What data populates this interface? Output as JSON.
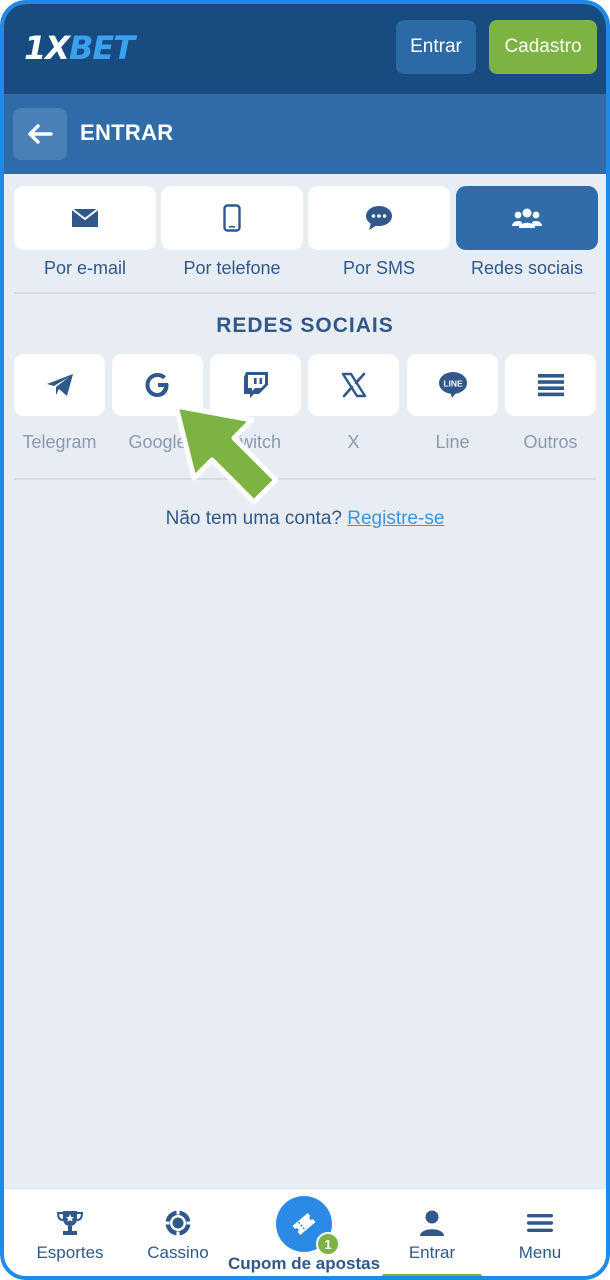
{
  "header": {
    "logo_prefix": "1X",
    "logo_suffix": "BET",
    "login_label": "Entrar",
    "register_label": "Cadastro"
  },
  "subheader": {
    "title": "ENTRAR"
  },
  "methods": [
    {
      "label": "Por e-mail",
      "icon": "envelope-icon",
      "active": false
    },
    {
      "label": "Por telefone",
      "icon": "phone-icon",
      "active": false
    },
    {
      "label": "Por SMS",
      "icon": "sms-icon",
      "active": false
    },
    {
      "label": "Redes sociais",
      "icon": "users-icon",
      "active": true
    }
  ],
  "social": {
    "title": "REDES SOCIAIS",
    "items": [
      {
        "label": "Telegram",
        "icon": "telegram-icon"
      },
      {
        "label": "Google",
        "icon": "google-icon"
      },
      {
        "label": "Twitch",
        "icon": "twitch-icon"
      },
      {
        "label": "X",
        "icon": "x-icon"
      },
      {
        "label": "Line",
        "icon": "line-icon"
      },
      {
        "label": "Outros",
        "icon": "menu-icon"
      }
    ]
  },
  "signup": {
    "question": "Não tem uma conta?",
    "link": "Registre-se"
  },
  "bottom_nav": {
    "items": [
      {
        "label": "Esportes",
        "icon": "trophy-icon"
      },
      {
        "label": "Cassino",
        "icon": "casino-chip-icon"
      },
      {
        "label": "Entrar",
        "icon": "user-icon",
        "active": true
      },
      {
        "label": "Menu",
        "icon": "hamburger-icon"
      }
    ],
    "coupon_label": "Cupom de apostas",
    "coupon_count": "1"
  },
  "colors": {
    "header": "#184c80",
    "subheader": "#2f6ca8",
    "accent_green": "#7cb342",
    "accent_blue": "#2b8ae6",
    "text": "#30588a"
  }
}
